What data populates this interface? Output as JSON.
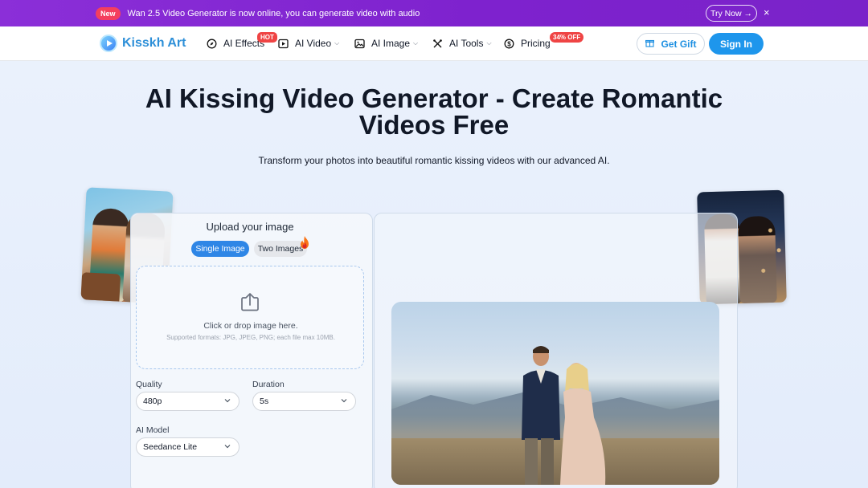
{
  "announcement": {
    "badge": "New",
    "text": "Wan 2.5 Video Generator is now online, you can generate video with audio",
    "cta": "Try Now →",
    "close": "×"
  },
  "nav": {
    "logo": "Kisskh Art",
    "items": [
      {
        "label": "AI Effects",
        "badge": "HOT"
      },
      {
        "label": "AI Video"
      },
      {
        "label": "AI Image"
      },
      {
        "label": "AI Tools"
      },
      {
        "label": "Pricing",
        "badge": "34% OFF"
      }
    ],
    "gift_button": "Get Gift",
    "sign_in_button": "Sign In"
  },
  "hero": {
    "title": "AI Kissing Video Generator - Create Romantic Videos Free",
    "subtitle": "Transform your photos into beautiful romantic kissing videos with our advanced AI."
  },
  "upload_panel": {
    "title": "Upload your image",
    "tabs": [
      "Single Image",
      "Two Images"
    ],
    "active_tab": "Single Image",
    "dropzone_text": "Click or drop image here.",
    "dropzone_hint": "Supported formats: JPG, JPEG, PNG; each file max 10MB.",
    "quality_label": "Quality",
    "quality_value": "480p",
    "duration_label": "Duration",
    "duration_value": "5s",
    "model_label": "AI Model",
    "model_value": "Seedance Lite"
  },
  "colors": {
    "announce_bg": "#7e22ce",
    "accent": "#1e96ec",
    "hot_badge": "#ef4444"
  }
}
